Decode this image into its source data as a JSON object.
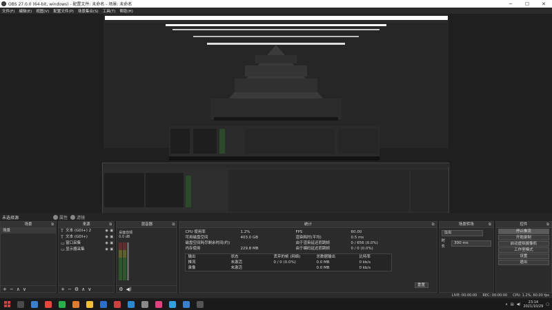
{
  "window": {
    "title": "OBS 27.0.0 (64-bit, windows) - 配置文件: 未命名 - 场景: 未命名",
    "minimize": "─",
    "maximize": "☐",
    "close": "✕"
  },
  "menu": [
    "文件(F)",
    "编辑(E)",
    "视图(V)",
    "配置文件(P)",
    "场景集合(S)",
    "工具(T)",
    "帮助(H)"
  ],
  "scenebar": {
    "scene_name": "未选择源",
    "properties": "属性",
    "filters": "滤镜"
  },
  "docks": {
    "scenes": {
      "title": "场景",
      "items": [
        "场景"
      ],
      "footer": [
        "+",
        "−",
        "∧",
        "∨"
      ]
    },
    "sources": {
      "title": "来源",
      "items": [
        {
          "icon": "T",
          "label": "文本 (GDI+) 2"
        },
        {
          "icon": "T",
          "label": "文本 (GDI+)"
        },
        {
          "icon": "▭",
          "label": "窗口采集"
        },
        {
          "icon": "▭",
          "label": "显示器采集"
        }
      ],
      "footer": [
        "+",
        "−",
        "⚙",
        "∧",
        "∨"
      ]
    },
    "mixer": {
      "title": "混音器",
      "label": "桌面音频",
      "db": "0.0 dB"
    },
    "stats": {
      "title": "统计",
      "rows": [
        [
          "CPU 使用率",
          "1.2%",
          "FPS",
          "60.00"
        ],
        [
          "可用磁盘空间",
          "403.0 GB",
          "渲染耗时(平均)",
          "0.5 ms"
        ],
        [
          "磁盘空间耗尽剩余时间(约)",
          "",
          "由于渲染延迟而跳帧",
          "0 / 656 (0.0%)"
        ],
        [
          "内存使用",
          "229.8 MB",
          "由于编码延迟而跳帧",
          "0 / 0 (0.0%)"
        ]
      ],
      "out_headers": [
        "输出",
        "状态",
        "丢弃的帧 (网络)",
        "总数据输出",
        "比特率"
      ],
      "out_rows": [
        [
          "推流",
          "未激活",
          "0 / 0 (0.0%)",
          "0.0 MB",
          "0 kb/s"
        ],
        [
          "录像",
          "未激活",
          "",
          "0.0 MB",
          "0 kb/s"
        ]
      ],
      "reset": "重置"
    },
    "transitions": {
      "title": "场景转场",
      "selected": "淡出",
      "duration_label": "时长",
      "duration": "300 ms"
    },
    "controls": {
      "title": "控件",
      "buttons": [
        "停止推流",
        "开始录制",
        "启动虚拟摄像机",
        "工作室模式",
        "设置",
        "退出"
      ]
    }
  },
  "status": {
    "live": "LIVE: 00:00:00",
    "rec": "REC: 00:00:00",
    "cpu": "CPU: 1.2%, 60.00 fps"
  },
  "taskbar": {
    "time": "23:14",
    "date": "2021/10/29",
    "icon_colors": [
      "#4a4a4a",
      "#3a80d0",
      "#e8453c",
      "#2ab04a",
      "#e07b2a",
      "#f0c030",
      "#2a6fd0",
      "#d04040",
      "#2a8ad0",
      "#8a8a8a",
      "#e04080",
      "#30a0e0",
      "#3a80d0",
      "#555555"
    ]
  }
}
